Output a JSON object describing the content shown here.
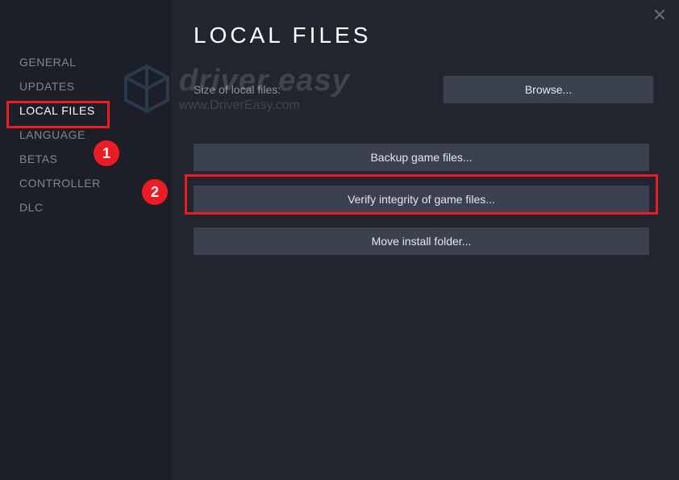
{
  "page_title": "LOCAL FILES",
  "size_label": "Size of local files:",
  "sidebar": {
    "items": [
      {
        "label": "GENERAL"
      },
      {
        "label": "UPDATES"
      },
      {
        "label": "LOCAL FILES"
      },
      {
        "label": "LANGUAGE"
      },
      {
        "label": "BETAS"
      },
      {
        "label": "CONTROLLER"
      },
      {
        "label": "DLC"
      }
    ],
    "active_index": 2
  },
  "buttons": {
    "browse": "Browse...",
    "backup": "Backup game files...",
    "verify": "Verify integrity of game files...",
    "move": "Move install folder..."
  },
  "annotations": {
    "callout1": "1",
    "callout2": "2"
  },
  "watermark": {
    "line1": "driver easy",
    "line2": "www.DriverEasy.com"
  },
  "colors": {
    "annotation_red": "#ed1c24",
    "button_bg": "#3b414f",
    "sidebar_bg": "#1c1f27",
    "main_bg": "#22252e"
  }
}
